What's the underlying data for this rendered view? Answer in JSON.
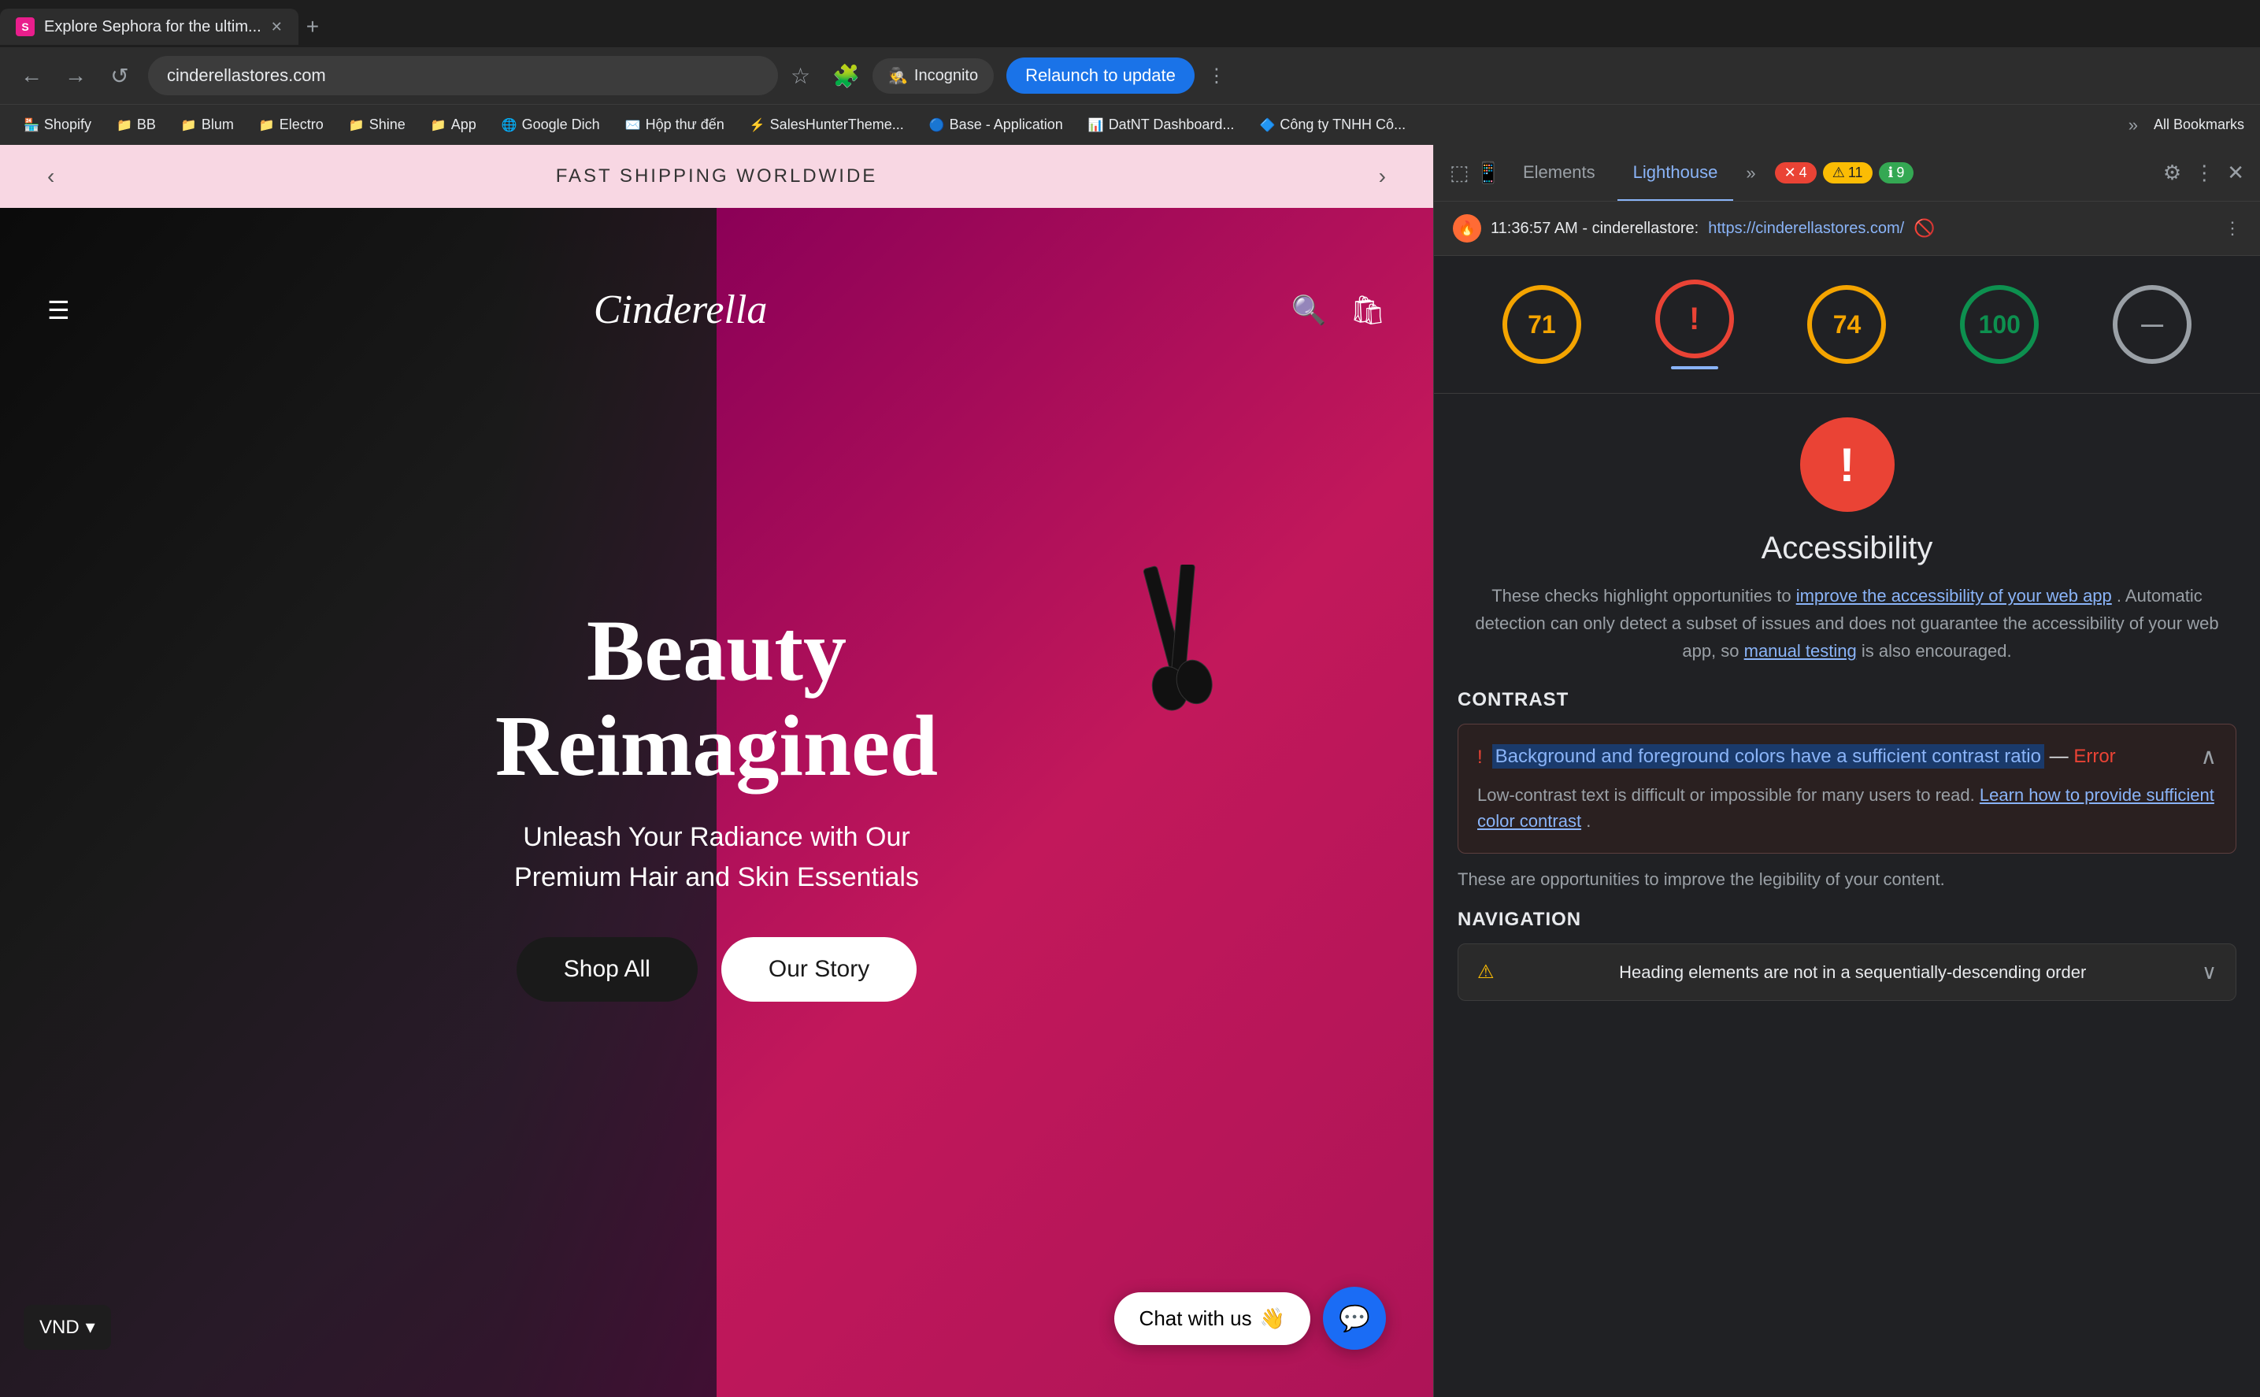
{
  "browser": {
    "tab": {
      "favicon_label": "S",
      "title": "Explore Sephora for the ultim...",
      "close_icon": "✕",
      "new_tab_icon": "+"
    },
    "address_bar": {
      "url": "cinderellastores.com",
      "back_icon": "←",
      "forward_icon": "→",
      "reload_icon": "↺",
      "bookmark_icon": "☆",
      "extensions_icon": "🧩",
      "incognito_label": "Incognito",
      "relaunch_label": "Relaunch to update"
    },
    "bookmarks": [
      {
        "icon": "🏪",
        "label": "Shopify"
      },
      {
        "icon": "📁",
        "label": "BB"
      },
      {
        "icon": "📁",
        "label": "Blum"
      },
      {
        "icon": "📁",
        "label": "Electro"
      },
      {
        "icon": "📁",
        "label": "Shine"
      },
      {
        "icon": "📁",
        "label": "App"
      },
      {
        "icon": "🌐",
        "label": "Google Dich"
      },
      {
        "icon": "✉️",
        "label": "Hộp thư đến"
      },
      {
        "icon": "⚡",
        "label": "SalesHunterTheme..."
      },
      {
        "icon": "🔵",
        "label": "Base - Application"
      },
      {
        "icon": "📊",
        "label": "DatNT Dashboard..."
      },
      {
        "icon": "🔷",
        "label": "Công ty TNHH Cô..."
      }
    ],
    "more_extensions": "»",
    "all_bookmarks": "All Bookmarks"
  },
  "website": {
    "announcement": {
      "text": "FAST SHIPPING WORLDWIDE",
      "left_arrow": "‹",
      "right_arrow": "›"
    },
    "header": {
      "menu_icon": "☰",
      "logo": "Cinderella",
      "search_icon": "🔍",
      "cart_icon": "🛍"
    },
    "hero": {
      "title_line1": "Beauty",
      "title_line2": "Reimagined",
      "subtitle": "Unleash Your Radiance with Our\nPremium Hair and Skin Essentials",
      "btn_shop_all": "Shop All",
      "btn_our_story": "Our Story"
    },
    "chat": {
      "label": "Chat with us",
      "emoji": "👋",
      "icon": "💬"
    },
    "currency": {
      "label": "VND",
      "arrow": "▾"
    }
  },
  "devtools": {
    "tabs": [
      {
        "label": "Elements",
        "active": false
      },
      {
        "label": "Lighthouse",
        "active": true
      }
    ],
    "more_icon": "»",
    "badges": {
      "error_count": "4",
      "error_icon": "✕",
      "warning_count": "11",
      "warning_icon": "⚠",
      "info_count": "9",
      "info_icon": "ℹ"
    },
    "toolbar": {
      "settings_icon": "⚙",
      "menu_icon": "⋮",
      "close_icon": "✕",
      "dock_icon": "⬜",
      "inspect_icon": "⬚",
      "device_icon": "📱"
    },
    "lighthouse_header": {
      "favicon_label": "🔥",
      "time": "11:36:57 AM - cinderellastore:",
      "url": "https://cinderellastores.com/",
      "refresh_icon": "🚫",
      "menu_icon": "⋮"
    },
    "scores": [
      {
        "value": "71",
        "type": "amber",
        "label": ""
      },
      {
        "value": "!",
        "type": "red",
        "label": "",
        "active": true
      },
      {
        "value": "74",
        "type": "green-74",
        "label": ""
      },
      {
        "value": "100",
        "type": "green-100",
        "label": ""
      },
      {
        "value": "—",
        "type": "gray",
        "label": ""
      }
    ],
    "accessibility": {
      "section_icon": "!",
      "title": "Accessibility",
      "description_part1": "These checks highlight opportunities to ",
      "link1": "improve the accessibility of your web app",
      "description_part2": ". Automatic detection can only detect a subset of issues and does not guarantee the accessibility of your web app, so ",
      "link2": "manual testing",
      "description_part3": " is also encouraged."
    },
    "contrast_section": {
      "title": "CONTRAST",
      "card": {
        "title_highlighted": "Background and foreground colors have a sufficient contrast ratio",
        "dash": " — ",
        "error_badge": "Error",
        "description": "Low-contrast text is difficult or impossible for many users to read. ",
        "link": "Learn how to provide sufficient color contrast",
        "period": "."
      }
    },
    "opportunities_text": "These are opportunities to improve the legibility of your content.",
    "navigation_section": {
      "title": "NAVIGATION",
      "card_title": "Heading elements are not in a sequentially-descending order"
    }
  }
}
